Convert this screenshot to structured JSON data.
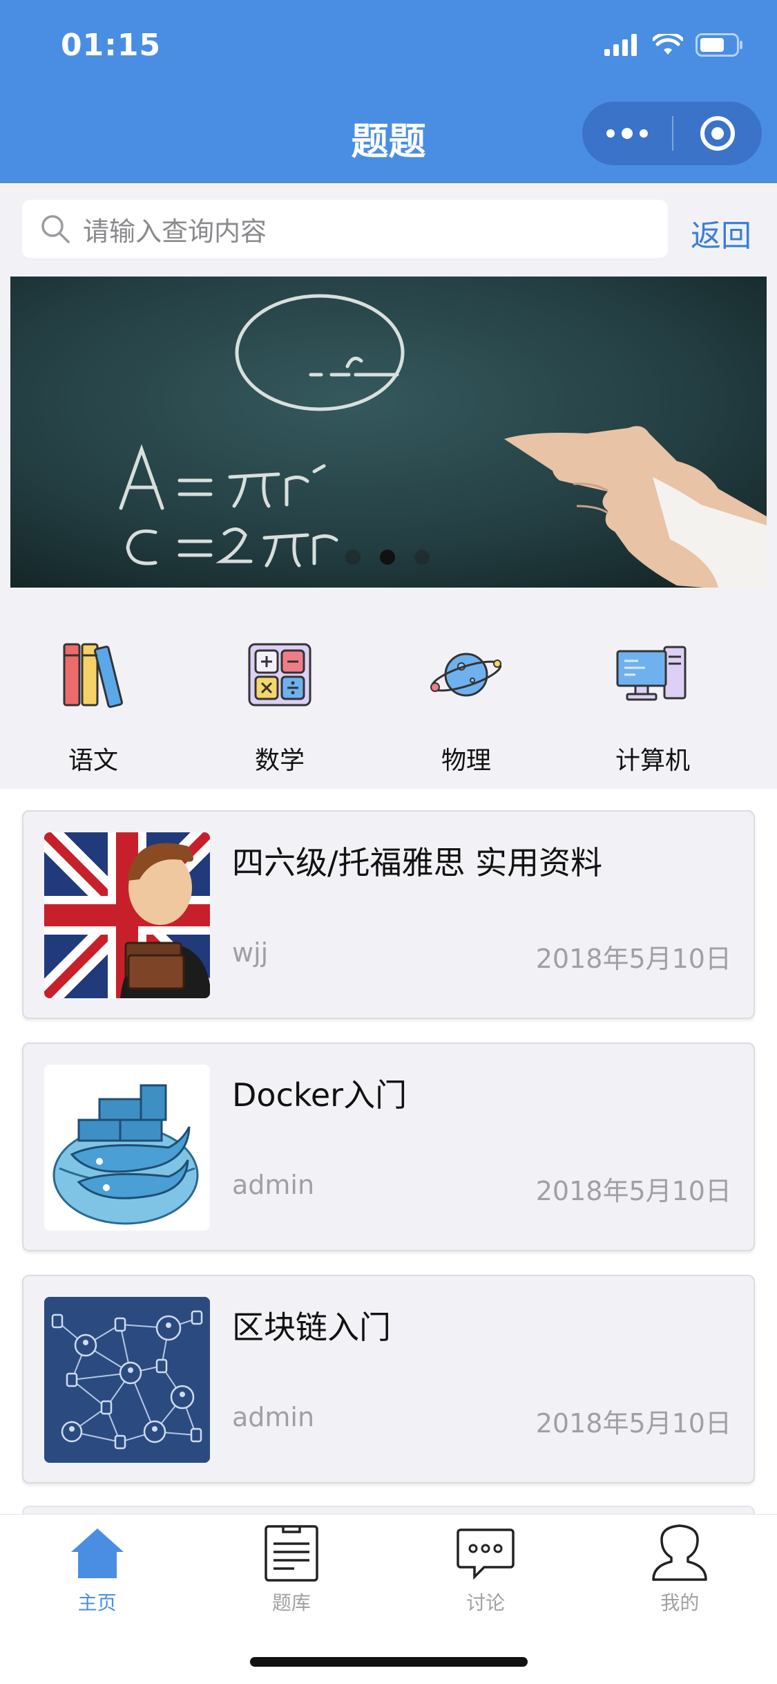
{
  "status_bar": {
    "time": "01:15"
  },
  "nav": {
    "title": "题题"
  },
  "search": {
    "placeholder": "请输入查询内容",
    "back_label": "返回"
  },
  "banner": {
    "slide_count": 3,
    "active_slide": 2
  },
  "categories": [
    {
      "label": "语文",
      "icon": "books-icon"
    },
    {
      "label": "数学",
      "icon": "calculator-icon"
    },
    {
      "label": "物理",
      "icon": "planet-icon"
    },
    {
      "label": "计算机",
      "icon": "computer-icon"
    }
  ],
  "articles": [
    {
      "title": "四六级/托福雅思 实用资料",
      "author": "wjj",
      "date": "2018年5月10日",
      "thumb": "uk-flag-student-image"
    },
    {
      "title": "Docker入门",
      "author": "admin",
      "date": "2018年5月10日",
      "thumb": "docker-whale-image"
    },
    {
      "title": "区块链入门",
      "author": "admin",
      "date": "2018年5月10日",
      "thumb": "blockchain-network-image"
    }
  ],
  "tabbar": {
    "items": [
      {
        "label": "主页",
        "icon": "home-icon",
        "active": true
      },
      {
        "label": "题库",
        "icon": "document-icon",
        "active": false
      },
      {
        "label": "讨论",
        "icon": "chat-icon",
        "active": false
      },
      {
        "label": "我的",
        "icon": "user-icon",
        "active": false
      }
    ]
  },
  "colors": {
    "primary": "#4a8ee4",
    "nav_capsule": "#3b73c8",
    "link": "#3a7fdc",
    "muted_text": "#a0a0a4"
  }
}
